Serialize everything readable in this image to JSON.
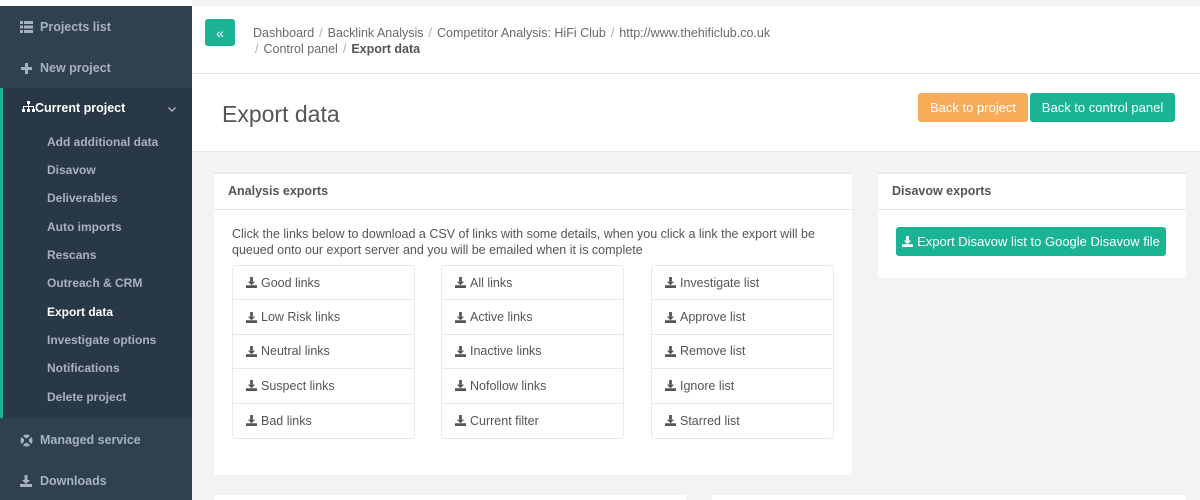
{
  "sidebar": {
    "projects_list": "Projects list",
    "new_project": "New project",
    "current_project": "Current project",
    "sub_items": [
      "Add additional data",
      "Disavow",
      "Deliverables",
      "Auto imports",
      "Rescans",
      "Outreach & CRM",
      "Export data",
      "Investigate options",
      "Notifications",
      "Delete project"
    ],
    "active_sub_item": "Export data",
    "managed_service": "Managed service",
    "downloads": "Downloads"
  },
  "topbar": {
    "toggle_label": "«",
    "breadcrumbs": [
      "Dashboard",
      "Backlink Analysis",
      "Competitor Analysis: HiFi Club",
      "http://www.thehificlub.co.uk",
      "Control panel"
    ],
    "current": "Export data"
  },
  "heading": {
    "title": "Export data",
    "back_to_project": "Back to project",
    "back_to_control_panel": "Back to control panel"
  },
  "analysis": {
    "title": "Analysis exports",
    "description": "Click the links below to download a CSV of links with some details, when you click a link the export will be queued onto our export server and you will be emailed when it is complete",
    "columns": [
      [
        "Good links",
        "Low Risk links",
        "Neutral links",
        "Suspect links",
        "Bad links"
      ],
      [
        "All links",
        "Active links",
        "Inactive links",
        "Nofollow links",
        "Current filter"
      ],
      [
        "Investigate list",
        "Approve list",
        "Remove list",
        "Ignore list",
        "Starred list"
      ]
    ]
  },
  "disavow": {
    "title": "Disavow exports",
    "button": "Export Disavow list to Google Disavow file"
  },
  "colors": {
    "sidebar_bg": "#2f4050",
    "sidebar_active_bg": "#293846",
    "primary": "#1ab394",
    "warning": "#f8ac59"
  }
}
